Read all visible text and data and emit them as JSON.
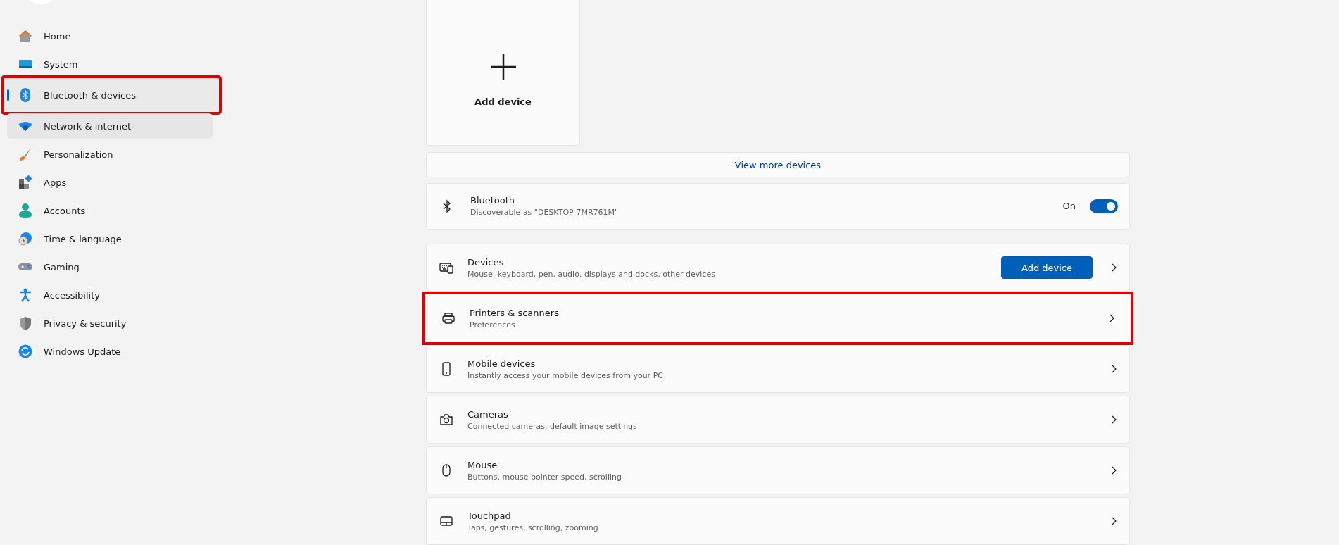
{
  "sidebar": {
    "items": [
      {
        "label": "Home",
        "selected": false,
        "hovered": false,
        "highlighted": false
      },
      {
        "label": "System",
        "selected": false,
        "hovered": false,
        "highlighted": false
      },
      {
        "label": "Bluetooth & devices",
        "selected": true,
        "hovered": false,
        "highlighted": true
      },
      {
        "label": "Network & internet",
        "selected": false,
        "hovered": true,
        "highlighted": false
      },
      {
        "label": "Personalization",
        "selected": false,
        "hovered": false,
        "highlighted": false
      },
      {
        "label": "Apps",
        "selected": false,
        "hovered": false,
        "highlighted": false
      },
      {
        "label": "Accounts",
        "selected": false,
        "hovered": false,
        "highlighted": false
      },
      {
        "label": "Time & language",
        "selected": false,
        "hovered": false,
        "highlighted": false
      },
      {
        "label": "Gaming",
        "selected": false,
        "hovered": false,
        "highlighted": false
      },
      {
        "label": "Accessibility",
        "selected": false,
        "hovered": false,
        "highlighted": false
      },
      {
        "label": "Privacy & security",
        "selected": false,
        "hovered": false,
        "highlighted": false
      },
      {
        "label": "Windows Update",
        "selected": false,
        "hovered": false,
        "highlighted": false
      }
    ]
  },
  "add_device_tile": {
    "label": "Add device"
  },
  "view_more": {
    "label": "View more devices"
  },
  "bluetooth": {
    "title": "Bluetooth",
    "subtitle": "Discoverable as \"DESKTOP-7MR761M\"",
    "state_label": "On",
    "on": true
  },
  "device_rows": [
    {
      "title": "Devices",
      "subtitle": "Mouse, keyboard, pen, audio, displays and docks, other devices",
      "button": "Add device",
      "highlighted": false
    },
    {
      "title": "Printers & scanners",
      "subtitle": "Preferences",
      "highlighted": true
    },
    {
      "title": "Mobile devices",
      "subtitle": "Instantly access your mobile devices from your PC",
      "highlighted": false
    },
    {
      "title": "Cameras",
      "subtitle": "Connected cameras, default image settings",
      "highlighted": false
    },
    {
      "title": "Mouse",
      "subtitle": "Buttons, mouse pointer speed, scrolling",
      "highlighted": false
    },
    {
      "title": "Touchpad",
      "subtitle": "Taps, gestures, scrolling, zooming",
      "highlighted": false
    }
  ]
}
